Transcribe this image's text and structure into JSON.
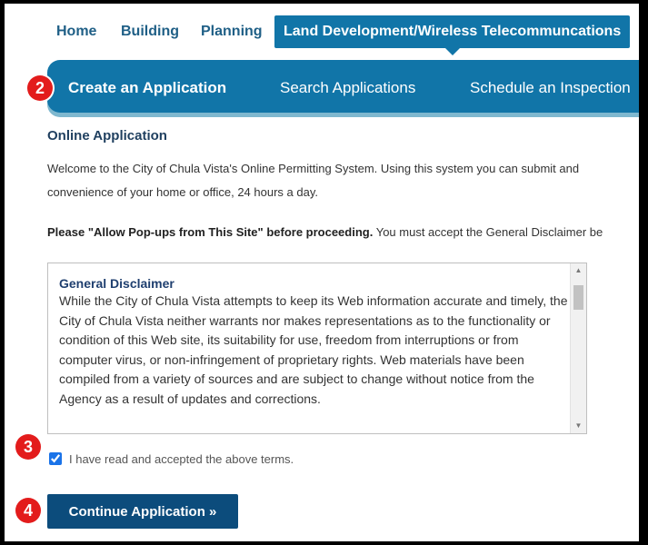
{
  "top_tabs": [
    {
      "label": "Home"
    },
    {
      "label": "Building"
    },
    {
      "label": "Planning"
    },
    {
      "label": "Land Development/Wireless Telecommuncations"
    }
  ],
  "sub_nav": [
    {
      "label": "Create an Application"
    },
    {
      "label": "Search Applications"
    },
    {
      "label": "Schedule an Inspection"
    }
  ],
  "markers": [
    "2",
    "3",
    "4"
  ],
  "content": {
    "heading": "Online Application",
    "welcome_line1": "Welcome to the City of Chula Vista's Online Permitting System. Using this system you can submit and",
    "welcome_line2": "convenience of your home or office, 24 hours a day.",
    "popup_bold": "Please \"Allow Pop-ups from This Site\" before proceeding.",
    "popup_rest": " You must accept the General Disclaimer be"
  },
  "disclaimer": {
    "title": "General Disclaimer",
    "text": "While the City of Chula Vista attempts to keep its Web information accurate and timely, the City of Chula Vista neither warrants nor makes representations as to the functionality or condition of this Web site, its suitability for use, freedom from interruptions or from computer virus, or non-infringement of proprietary rights. Web materials have been compiled from a variety of sources and are subject to change without notice from the Agency as a result of updates and corrections."
  },
  "accept": {
    "label": "I have read and accepted the above terms.",
    "checked": true
  },
  "continue_button": {
    "label": "Continue Application »"
  },
  "colors": {
    "nav_blue": "#1175a8",
    "button_navy": "#0c4c7c",
    "marker_red": "#e31c1c"
  }
}
